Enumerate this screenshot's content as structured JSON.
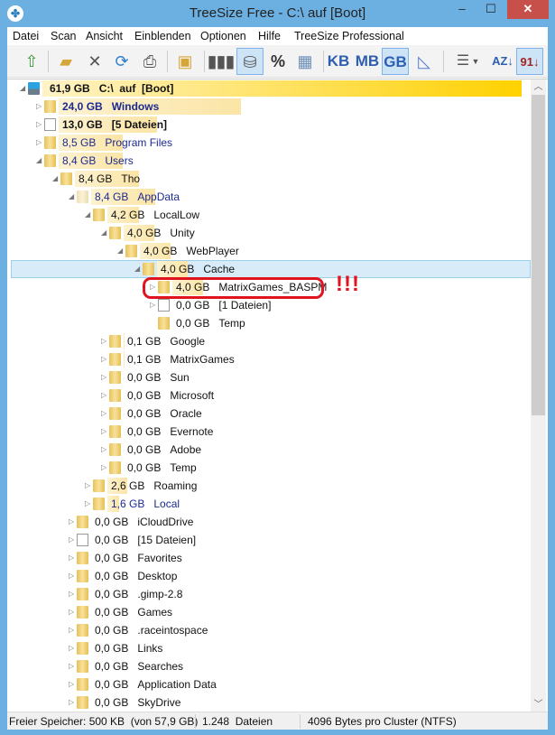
{
  "window": {
    "title": "TreeSize Free - C:\\  auf  [Boot]",
    "minimize": "–",
    "maximize": "☐",
    "close": "✕"
  },
  "menu": [
    "Datei",
    "Scan",
    "Ansicht",
    "Einblenden",
    "Optionen",
    "Hilfe",
    "TreeSize Professional"
  ],
  "toolbar": {
    "units": [
      "KB",
      "MB",
      "GB"
    ],
    "percent": "%",
    "active_unit": "GB"
  },
  "colors": {
    "accent": "#6cb0e2",
    "bar": "#fbe5a6",
    "root_bar": "#ffd100",
    "selected": "#d8ebf9",
    "alert": "#e0141e"
  },
  "total_gb": 61.9,
  "tree": [
    {
      "level": 0,
      "exp": "open",
      "icon": "drive",
      "size": "61,9 GB",
      "name": "C:\\  auf  [Boot]",
      "gb": 61.9,
      "bold": true
    },
    {
      "level": 1,
      "exp": "closed",
      "icon": "folder",
      "size": "24,0 GB",
      "name": "Windows",
      "gb": 24.0,
      "bold": true,
      "blue": true
    },
    {
      "level": 1,
      "exp": "closed",
      "icon": "file",
      "size": "13,0 GB",
      "name": "[5 Dateien]",
      "gb": 13.0,
      "bold": true
    },
    {
      "level": 1,
      "exp": "closed",
      "icon": "folder",
      "size": "8,5 GB",
      "name": "Program Files",
      "gb": 8.5,
      "blue": true
    },
    {
      "level": 1,
      "exp": "open",
      "icon": "folder",
      "size": "8,4 GB",
      "name": "Users",
      "gb": 8.4,
      "blue": true
    },
    {
      "level": 2,
      "exp": "open",
      "icon": "folder",
      "size": "8,4 GB",
      "name": "Tho",
      "gb": 8.4
    },
    {
      "level": 3,
      "exp": "open",
      "icon": "folder-pale",
      "size": "8,4 GB",
      "name": "AppData",
      "gb": 8.4,
      "blue": true
    },
    {
      "level": 4,
      "exp": "open",
      "icon": "folder",
      "size": "4,2 GB",
      "name": "LocalLow",
      "gb": 4.2
    },
    {
      "level": 5,
      "exp": "open",
      "icon": "folder",
      "size": "4,0 GB",
      "name": "Unity",
      "gb": 4.0
    },
    {
      "level": 6,
      "exp": "open",
      "icon": "folder",
      "size": "4,0 GB",
      "name": "WebPlayer",
      "gb": 4.0
    },
    {
      "level": 7,
      "exp": "open",
      "icon": "folder",
      "size": "4,0 GB",
      "name": "Cache",
      "gb": 4.0,
      "selected": true
    },
    {
      "level": 8,
      "exp": "closed",
      "icon": "folder",
      "size": "4,0 GB",
      "name": "MatrixGames_BASPM",
      "gb": 4.0
    },
    {
      "level": 8,
      "exp": "closed",
      "icon": "file",
      "size": "0,0 GB",
      "name": "[1 Dateien]",
      "gb": 0
    },
    {
      "level": 8,
      "exp": "none",
      "icon": "folder",
      "size": "0,0 GB",
      "name": "Temp",
      "gb": 0
    },
    {
      "level": 5,
      "exp": "closed",
      "icon": "folder",
      "size": "0,1 GB",
      "name": "Google",
      "gb": 0.1
    },
    {
      "level": 5,
      "exp": "closed",
      "icon": "folder",
      "size": "0,1 GB",
      "name": "MatrixGames",
      "gb": 0.1
    },
    {
      "level": 5,
      "exp": "closed",
      "icon": "folder",
      "size": "0,0 GB",
      "name": "Sun",
      "gb": 0
    },
    {
      "level": 5,
      "exp": "closed",
      "icon": "folder",
      "size": "0,0 GB",
      "name": "Microsoft",
      "gb": 0
    },
    {
      "level": 5,
      "exp": "closed",
      "icon": "folder",
      "size": "0,0 GB",
      "name": "Oracle",
      "gb": 0
    },
    {
      "level": 5,
      "exp": "closed",
      "icon": "folder",
      "size": "0,0 GB",
      "name": "Evernote",
      "gb": 0
    },
    {
      "level": 5,
      "exp": "closed",
      "icon": "folder",
      "size": "0,0 GB",
      "name": "Adobe",
      "gb": 0
    },
    {
      "level": 5,
      "exp": "closed",
      "icon": "folder",
      "size": "0,0 GB",
      "name": "Temp",
      "gb": 0
    },
    {
      "level": 4,
      "exp": "closed",
      "icon": "folder",
      "size": "2,6 GB",
      "name": "Roaming",
      "gb": 2.6
    },
    {
      "level": 4,
      "exp": "closed",
      "icon": "folder",
      "size": "1,6 GB",
      "name": "Local",
      "gb": 1.6,
      "blue": true
    },
    {
      "level": 3,
      "exp": "closed",
      "icon": "folder",
      "size": "0,0 GB",
      "name": "iCloudDrive",
      "gb": 0
    },
    {
      "level": 3,
      "exp": "closed",
      "icon": "file",
      "size": "0,0 GB",
      "name": "[15 Dateien]",
      "gb": 0
    },
    {
      "level": 3,
      "exp": "closed",
      "icon": "folder",
      "size": "0,0 GB",
      "name": "Favorites",
      "gb": 0
    },
    {
      "level": 3,
      "exp": "closed",
      "icon": "folder",
      "size": "0,0 GB",
      "name": "Desktop",
      "gb": 0
    },
    {
      "level": 3,
      "exp": "closed",
      "icon": "folder",
      "size": "0,0 GB",
      "name": ".gimp-2.8",
      "gb": 0
    },
    {
      "level": 3,
      "exp": "closed",
      "icon": "folder",
      "size": "0,0 GB",
      "name": "Games",
      "gb": 0
    },
    {
      "level": 3,
      "exp": "closed",
      "icon": "folder",
      "size": "0,0 GB",
      "name": ".raceintospace",
      "gb": 0
    },
    {
      "level": 3,
      "exp": "closed",
      "icon": "folder",
      "size": "0,0 GB",
      "name": "Links",
      "gb": 0
    },
    {
      "level": 3,
      "exp": "closed",
      "icon": "folder",
      "size": "0,0 GB",
      "name": "Searches",
      "gb": 0
    },
    {
      "level": 3,
      "exp": "closed",
      "icon": "folder",
      "size": "0,0 GB",
      "name": "Application Data",
      "gb": 0
    },
    {
      "level": 3,
      "exp": "closed",
      "icon": "folder",
      "size": "0,0 GB",
      "name": "SkyDrive",
      "gb": 0
    }
  ],
  "annotation": "!!!",
  "status": {
    "free": "Freier Speicher: 500 KB  (von 57,9 GB)",
    "files": "1.248  Dateien",
    "cluster": "4096 Bytes pro Cluster (NTFS)"
  }
}
